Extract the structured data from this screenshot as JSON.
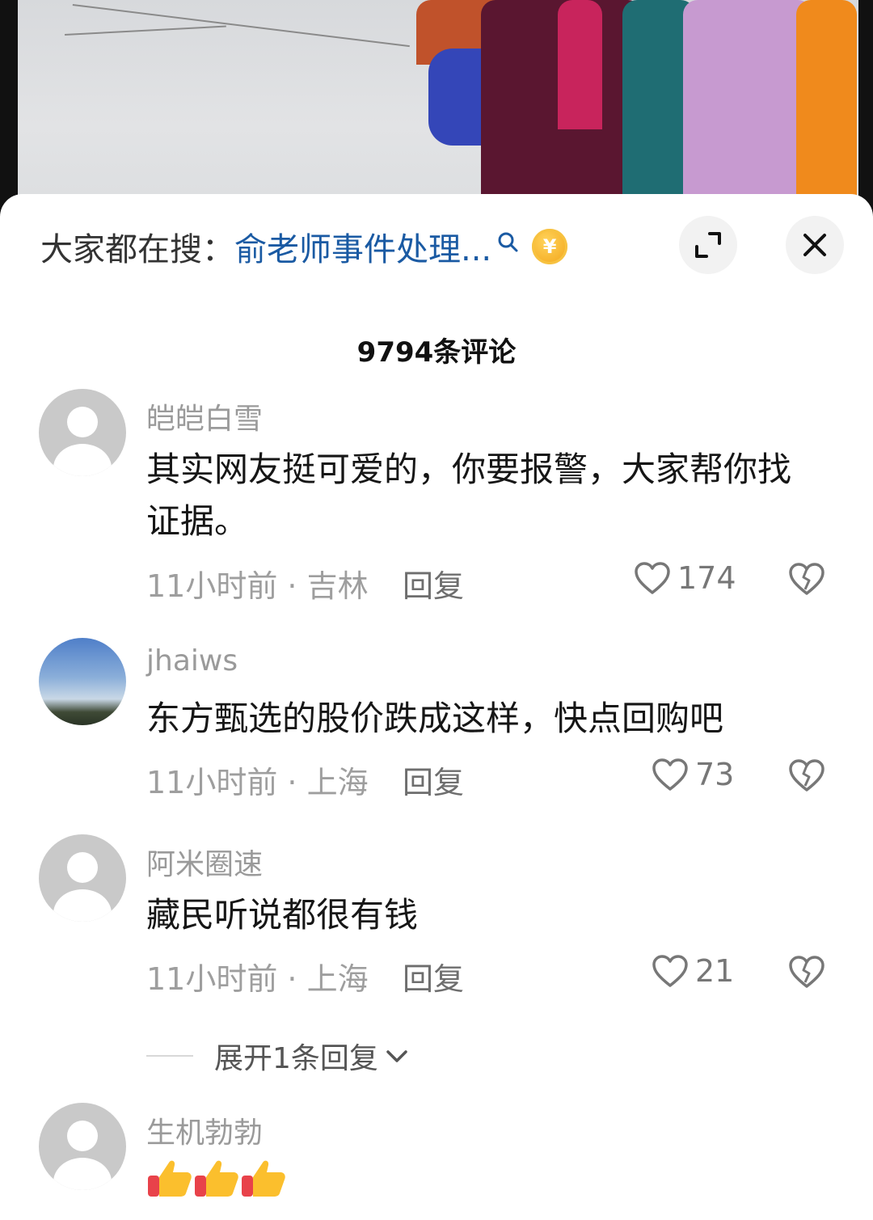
{
  "search": {
    "prefix": "大家都在搜：",
    "query": "俞老师事件处理...",
    "coin_symbol": "¥",
    "icons": [
      "search-icon",
      "coin-icon"
    ]
  },
  "actions": {
    "expand_icon": "expand-icon",
    "close_icon": "close-icon"
  },
  "comments_header": {
    "count_label": "9794条评论"
  },
  "comments": [
    {
      "username": "皑皑白雪",
      "text": "其实网友挺可爱的，你要报警，大家帮你找证据。",
      "meta": "11小时前 · 吉林",
      "reply_label": "回复",
      "likes": "174",
      "avatar": "default"
    },
    {
      "username": "jhaiws",
      "text": "东方甄选的股价跌成这样，快点回购吧",
      "meta": "11小时前 · 上海",
      "reply_label": "回复",
      "likes": "73",
      "avatar": "sky-photo"
    },
    {
      "username": "阿米圈速",
      "text": "藏民听说都很有钱",
      "meta": "11小时前 · 上海",
      "reply_label": "回复",
      "likes": "21",
      "avatar": "default",
      "expand_replies": "展开1条回复"
    },
    {
      "username": "生机勃勃",
      "text": "",
      "emoji": [
        "thumbs-up",
        "thumbs-up",
        "thumbs-up"
      ],
      "avatar": "default"
    }
  ],
  "colors": {
    "link_blue": "#1a5aa3",
    "meta_gray": "#9e9e9e",
    "coin_gold": "#f2a316"
  }
}
